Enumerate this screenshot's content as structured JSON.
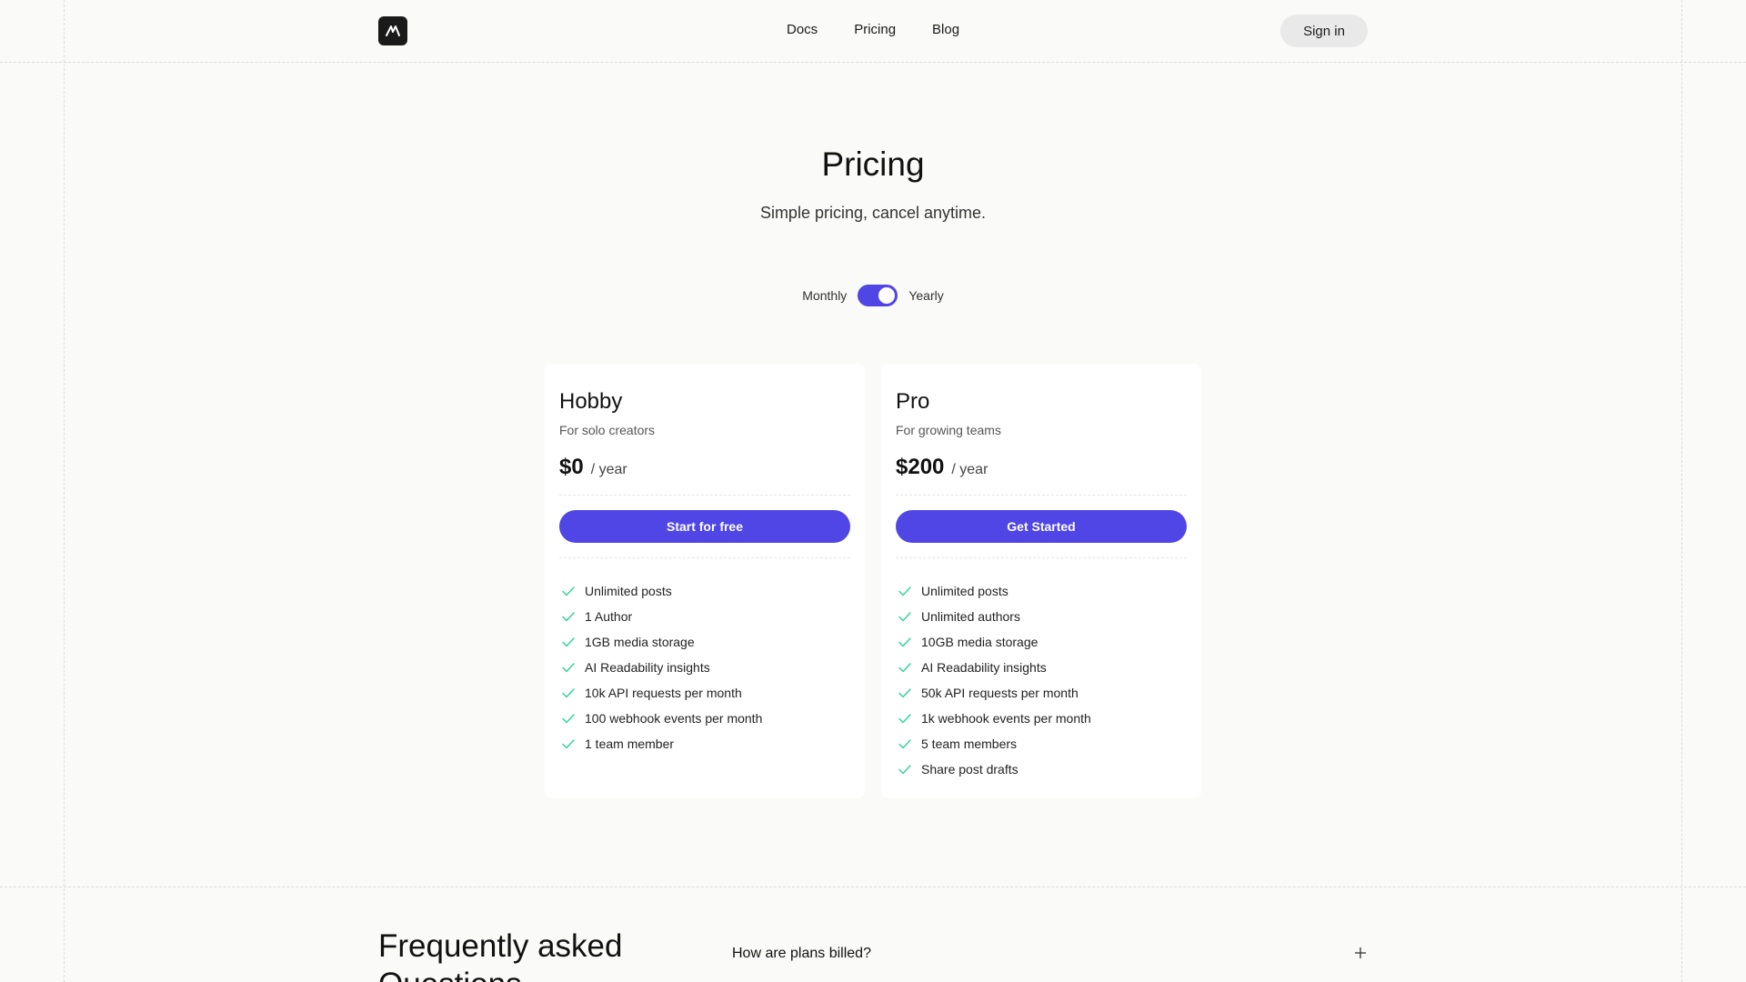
{
  "header": {
    "nav": [
      {
        "label": "Docs"
      },
      {
        "label": "Pricing"
      },
      {
        "label": "Blog"
      }
    ],
    "sign_in_label": "Sign in"
  },
  "hero": {
    "title": "Pricing",
    "subtitle": "Simple pricing, cancel anytime."
  },
  "billing_toggle": {
    "monthly_label": "Monthly",
    "yearly_label": "Yearly",
    "selected": "Yearly"
  },
  "plans": [
    {
      "name": "Hobby",
      "description": "For solo creators",
      "price": "$0",
      "period": "/ year",
      "cta": "Start for free",
      "features": [
        "Unlimited posts",
        "1 Author",
        "1GB media storage",
        "AI Readability insights",
        "10k API requests per month",
        "100 webhook events per month",
        "1 team member"
      ]
    },
    {
      "name": "Pro",
      "description": "For growing teams",
      "price": "$200",
      "period": "/ year",
      "cta": "Get Started",
      "features": [
        "Unlimited posts",
        "Unlimited authors",
        "10GB media storage",
        "AI Readability insights",
        "50k API requests per month",
        "1k webhook events per month",
        "5 team members",
        "Share post drafts"
      ]
    }
  ],
  "faq": {
    "title": "Frequently asked Questions",
    "questions": [
      "How are plans billed?"
    ]
  },
  "colors": {
    "accent": "#4f46e5",
    "check": "#34d399",
    "background": "#fafaf9"
  },
  "icons": {
    "logo": "logo-icon",
    "check": "check-icon",
    "plus": "plus-icon"
  }
}
